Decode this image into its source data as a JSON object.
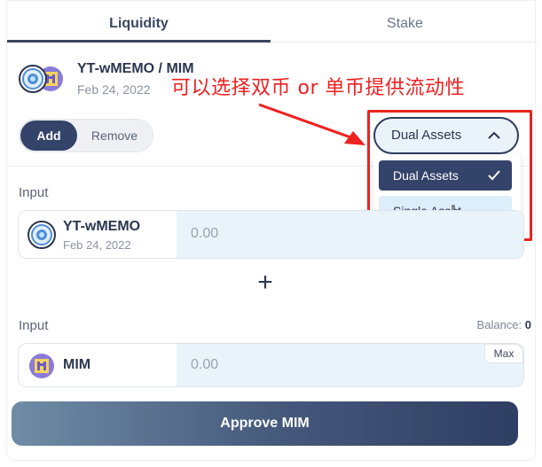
{
  "tabs": [
    {
      "label": "Liquidity",
      "active": true
    },
    {
      "label": "Stake",
      "active": false
    }
  ],
  "pair": {
    "title": "YT-wMEMO / MIM",
    "date": "Feb 24, 2022"
  },
  "annotation": {
    "text": "可以选择双币 or 单币提供流动性",
    "color": "#ef2020"
  },
  "mode_toggle": {
    "add_label": "Add",
    "remove_label": "Remove",
    "selected": "Add"
  },
  "asset_select": {
    "value": "Dual Assets",
    "options": [
      {
        "label": "Dual Assets",
        "selected": true
      },
      {
        "label": "Single Asset",
        "selected": false
      }
    ]
  },
  "input1": {
    "label": "Input",
    "token_name": "YT-wMEMO",
    "token_date": "Feb 24, 2022",
    "placeholder": "0.00",
    "icon": "ytwmemo-token-icon"
  },
  "plus_symbol": "+",
  "input2": {
    "label": "Input",
    "balance_label": "Balance:",
    "balance_value": "0",
    "token_name": "MIM",
    "placeholder": "0.00",
    "max_label": "Max",
    "icon": "mim-token-icon"
  },
  "approve_button": {
    "label": "Approve MIM"
  },
  "colors": {
    "primary": "#34436a",
    "input_bg": "#e8f3fa",
    "highlight": "#e8241e"
  }
}
